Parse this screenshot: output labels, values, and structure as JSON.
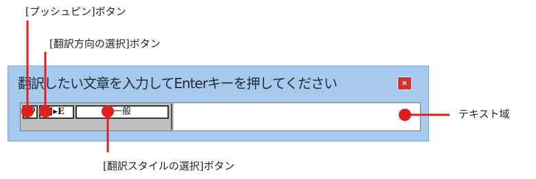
{
  "callouts": {
    "pushpin_button": "[プッシュピン]ボタン",
    "direction_button": "[翻訳方向の選択]ボタン",
    "style_button": "[翻訳スタイルの選択]ボタン",
    "text_area": "テキスト域"
  },
  "window": {
    "prompt": "翻訳したい文章を入力してEnterキーを押してください",
    "close_label": "×"
  },
  "toolbar": {
    "direction_label": "J▸E",
    "style_label": "一般"
  },
  "colors": {
    "marker_red": "#e01e1e",
    "panel_blue": "#a8c9ee",
    "close_red": "#cc3333"
  },
  "icons": {
    "pushpin": "pushpin-icon"
  }
}
